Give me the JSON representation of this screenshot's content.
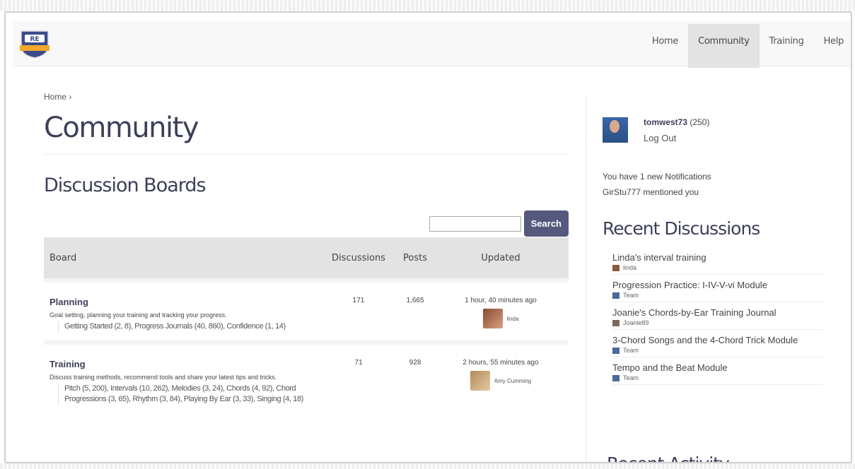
{
  "nav": {
    "home": "Home",
    "community": "Community",
    "training": "Training",
    "help": "Help"
  },
  "breadcrumb": "Home ›",
  "page_title": "Community",
  "section_title": "Discussion Boards",
  "search": {
    "button": "Search",
    "placeholder": ""
  },
  "boards_header": {
    "board": "Board",
    "discussions": "Discussions",
    "posts": "Posts",
    "updated": "Updated"
  },
  "boards": [
    {
      "name": "Planning",
      "description": "Goal setting, planning your training and tracking your progress.",
      "subforums": "Getting Started (2, 8), Progress Journals (40, 860), Confidence (1, 14)",
      "discussions": "171",
      "posts": "1,665",
      "updated": "1 hour, 40 minutes ago",
      "updated_by": "linda"
    },
    {
      "name": "Training",
      "description": "Discuss training methods, recommend tools and share your latest tips and tricks.",
      "subforums": "Pitch (5, 200), Intervals (10, 262), Melodies (3, 24), Chords (4, 92), Chord Progressions (3, 65), Rhythm (3, 84), Playing By Ear (3, 33), Singing (4, 18)",
      "discussions": "71",
      "posts": "928",
      "updated": "2 hours, 55 minutes ago",
      "updated_by": "Amy Cumming"
    }
  ],
  "user": {
    "name": "tomwest73",
    "points": "(250)",
    "logout": "Log Out"
  },
  "notifications": {
    "line1": "You have 1 new Notifications",
    "line2": "GirStu777 mentioned you"
  },
  "recent_title": "Recent Discussions",
  "recent": [
    {
      "title": "Linda's interval training",
      "by": "linda"
    },
    {
      "title": "Progression Practice: I-IV-V-vi Module",
      "by": "Team"
    },
    {
      "title": "Joanie's Chords-by-Ear Training Journal",
      "by": "Joanie89"
    },
    {
      "title": "3-Chord Songs and the 4-Chord Trick Module",
      "by": "Team"
    },
    {
      "title": "Tempo and the Beat Module",
      "by": "Team"
    }
  ],
  "recent_activity_title": "Recent Activity",
  "colors": {
    "accent": "#55597d",
    "heading": "#3d3f5a"
  }
}
